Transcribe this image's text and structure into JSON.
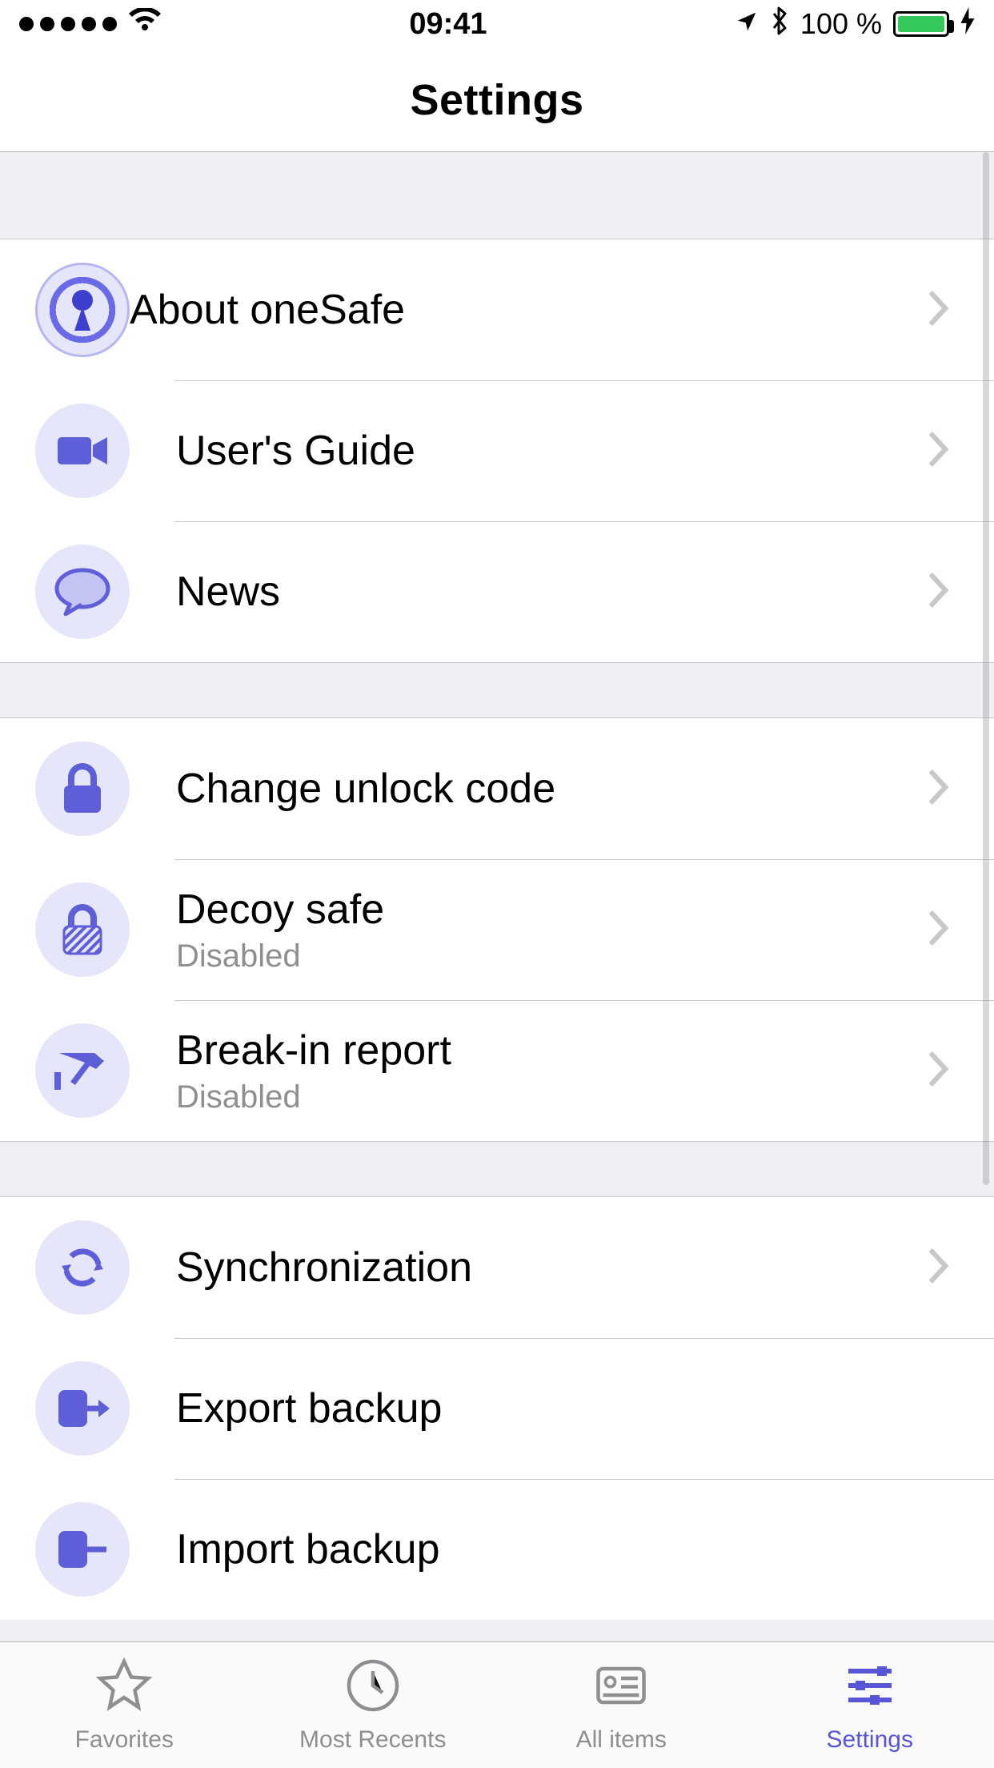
{
  "status": {
    "time": "09:41",
    "battery_pct": "100 %"
  },
  "nav": {
    "title": "Settings"
  },
  "groups": [
    {
      "rows": [
        {
          "icon": "keyhole-icon",
          "title": "About oneSafe",
          "subtitle": null,
          "chevron": true
        },
        {
          "icon": "video-icon",
          "title": "User's Guide",
          "subtitle": null,
          "chevron": true
        },
        {
          "icon": "chat-icon",
          "title": "News",
          "subtitle": null,
          "chevron": true
        }
      ]
    },
    {
      "rows": [
        {
          "icon": "lock-icon",
          "title": "Change unlock code",
          "subtitle": null,
          "chevron": true
        },
        {
          "icon": "decoy-icon",
          "title": "Decoy safe",
          "subtitle": "Disabled",
          "chevron": true
        },
        {
          "icon": "cctv-icon",
          "title": "Break-in report",
          "subtitle": "Disabled",
          "chevron": true
        }
      ]
    },
    {
      "rows": [
        {
          "icon": "sync-icon",
          "title": "Synchronization",
          "subtitle": null,
          "chevron": true
        },
        {
          "icon": "export-icon",
          "title": "Export backup",
          "subtitle": null,
          "chevron": false
        },
        {
          "icon": "import-icon",
          "title": "Import backup",
          "subtitle": null,
          "chevron": false
        }
      ]
    }
  ],
  "tabs": [
    {
      "icon": "star-icon",
      "label": "Favorites",
      "active": false
    },
    {
      "icon": "clock-icon",
      "label": "Most Recents",
      "active": false
    },
    {
      "icon": "card-icon",
      "label": "All items",
      "active": false
    },
    {
      "icon": "sliders-icon",
      "label": "Settings",
      "active": true
    }
  ],
  "colors": {
    "accent": "#5856d6",
    "iconBg": "#e6e6fb",
    "iconFg": "#5e5ed8"
  }
}
